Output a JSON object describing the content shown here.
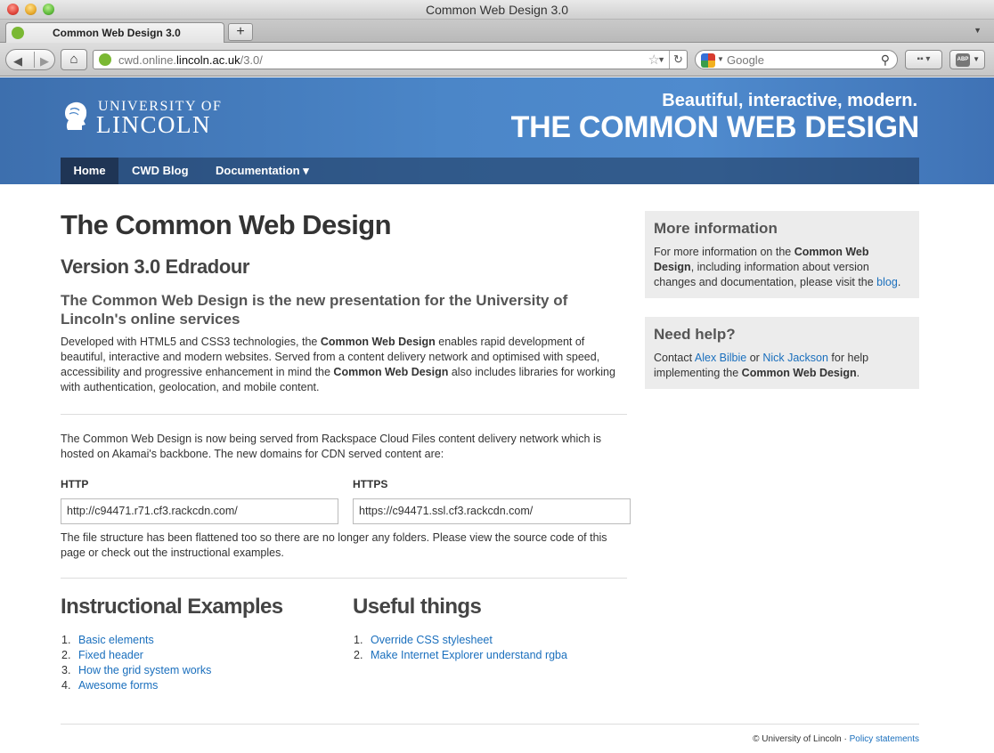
{
  "browser": {
    "window_title": "Common Web Design 3.0",
    "tab_label": "Common Web Design 3.0",
    "new_tab": "+",
    "url_prefix": "cwd.online.",
    "url_host": "lincoln.ac.uk",
    "url_suffix": "/3.0/",
    "search_placeholder": "Google",
    "abp_label": "ABP"
  },
  "header": {
    "logo_line1": "UNIVERSITY OF",
    "logo_line2": "LINCOLN",
    "tagline": "Beautiful, interactive, modern.",
    "site_title": "THE COMMON WEB DESIGN"
  },
  "nav": {
    "items": [
      {
        "label": "Home",
        "active": true
      },
      {
        "label": "CWD Blog",
        "active": false
      },
      {
        "label": "Documentation ▾",
        "active": false
      }
    ]
  },
  "main": {
    "title": "The Common Web Design",
    "version": "Version 3.0 Edradour",
    "lead": "The Common Web Design is the new presentation for the University of Lincoln's online services",
    "intro_parts": [
      "Developed with HTML5 and CSS3 technologies, the ",
      "Common Web Design",
      " enables rapid development of beautiful, interactive and modern websites. Served from a content delivery network and optimised with speed, accessibility and progressive enhancement in mind the ",
      "Common Web Design",
      " also includes libraries for working with authentication, geolocation, and mobile content."
    ],
    "cdn_intro": "The Common Web Design is now being served from Rackspace Cloud Files content delivery network which is hosted on Akamai's backbone. The new domains for CDN served content are:",
    "http_label": "HTTP",
    "http_value": "http://c94471.r71.cf3.rackcdn.com/",
    "https_label": "HTTPS",
    "https_value": "https://c94471.ssl.cf3.rackcdn.com/",
    "flattened": "The file structure has been flattened too so there are no longer any folders. Please view the source code of this page or check out the instructional examples.",
    "examples_title": "Instructional Examples",
    "examples": [
      "Basic elements",
      "Fixed header",
      "How the grid system works",
      "Awesome forms"
    ],
    "useful_title": "Useful things",
    "useful": [
      "Override CSS stylesheet",
      "Make Internet Explorer understand rgba"
    ]
  },
  "sidebar": {
    "more_title": "More information",
    "more_parts": [
      "For more information on the ",
      "Common Web Design",
      ", including information about version changes and documentation, please visit the ",
      "blog",
      "."
    ],
    "help_title": "Need help?",
    "help_parts": [
      "Contact ",
      "Alex Bilbie",
      " or ",
      "Nick Jackson",
      " for help implementing the ",
      "Common Web Design",
      "."
    ]
  },
  "footer": {
    "copyright": "© University of Lincoln · ",
    "policy": "Policy statements"
  }
}
